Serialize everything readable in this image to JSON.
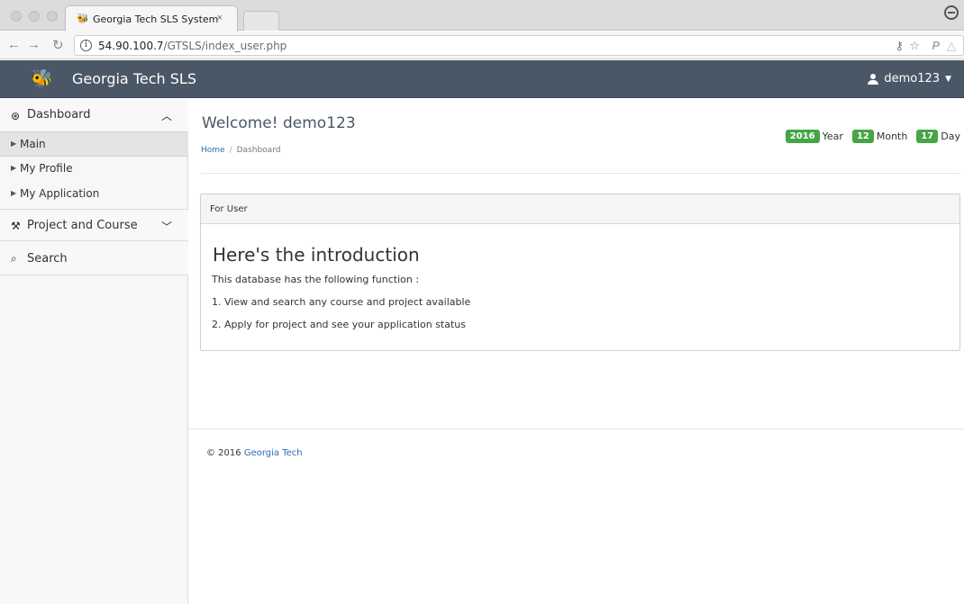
{
  "browser": {
    "tab_title": "Georgia Tech SLS System",
    "tab_close": "×",
    "url_host": "54.90.100.7",
    "url_path": "/GTSLS/index_user.php"
  },
  "navbar": {
    "brand": "Georgia Tech SLS",
    "user": "demo123"
  },
  "sidebar": {
    "groups": [
      {
        "label": "Dashboard",
        "icon": "tachometer-icon",
        "expanded": true
      },
      {
        "label": "Project and Course",
        "icon": "wrench-icon",
        "expanded": false
      },
      {
        "label": "Search",
        "icon": "search-icon"
      }
    ],
    "items": [
      {
        "label": "Main",
        "active": true
      },
      {
        "label": "My Profile",
        "active": false
      },
      {
        "label": "My Application",
        "active": false
      }
    ]
  },
  "main": {
    "title": "Welcome! demo123",
    "breadcrumb": {
      "home": "Home",
      "current": "Dashboard"
    },
    "date": {
      "year_value": "2016",
      "year_label": "Year",
      "month_value": "12",
      "month_label": "Month",
      "day_value": "17",
      "day_label": "Day"
    },
    "panel": {
      "heading": "For User",
      "title": "Here's the introduction",
      "lines": [
        "This database has the following function :",
        "1. View and search any course and project available",
        "2. Apply for project and see your application status"
      ]
    },
    "footer": {
      "copyright": "© 2016",
      "org": "Georgia Tech"
    }
  },
  "colors": {
    "navbar_bg": "#4a5766",
    "badge_green": "#46a546",
    "link_blue": "#2a6db5"
  }
}
